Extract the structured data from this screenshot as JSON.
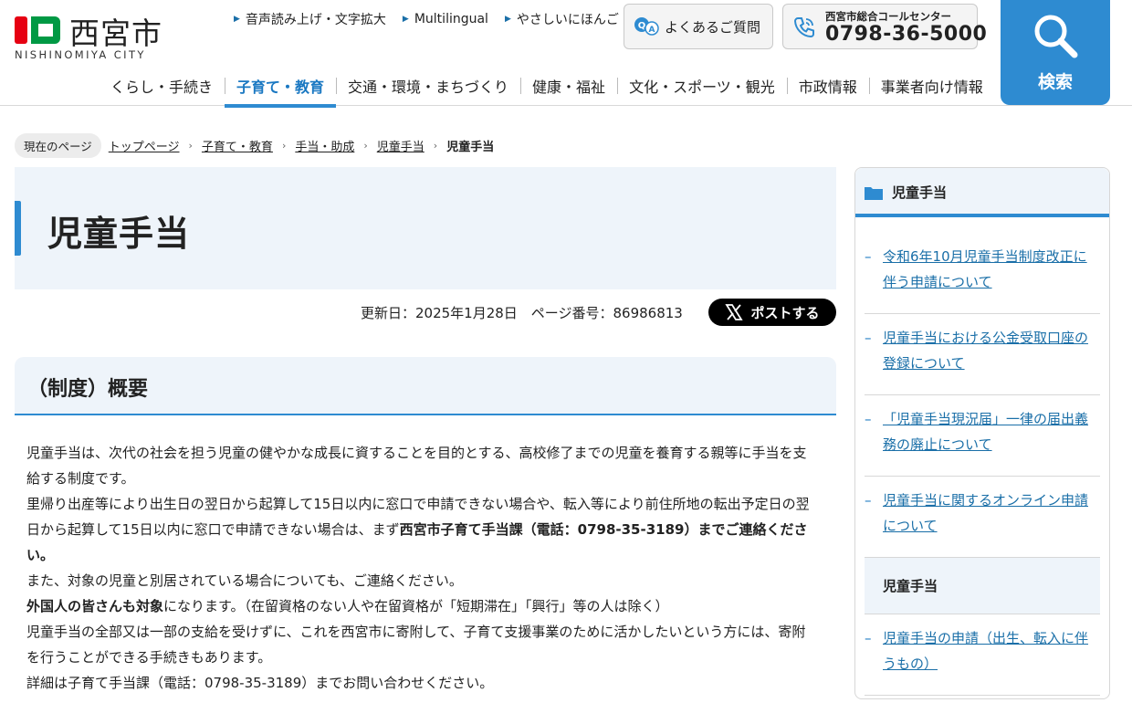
{
  "header": {
    "logo_jp": "西宮市",
    "logo_en": "NISHINOMIYA CITY",
    "util_links": [
      "音声読み上げ・文字拡大",
      "Multilingual",
      "やさしいにほんご"
    ],
    "faq_label": "よくあるご質問",
    "call_center_label": "西宮市総合コールセンター",
    "call_center_number": "0798-36-5000",
    "search_label": "検索",
    "nav": [
      "くらし・手続き",
      "子育て・教育",
      "交通・環境・まちづくり",
      "健康・福祉",
      "文化・スポーツ・観光",
      "市政情報",
      "事業者向け情報"
    ],
    "nav_active_index": 1,
    "brand_color": "#2e8bd1",
    "logo_red": "#e60012",
    "logo_green": "#009944"
  },
  "breadcrumb": {
    "current_label": "現在のページ",
    "links": [
      "トップページ",
      "子育て・教育",
      "手当・助成",
      "児童手当"
    ],
    "here": "児童手当"
  },
  "main": {
    "title": "児童手当",
    "meta": "更新日：2025年1月28日　ページ番号：86986813",
    "post_label": "ポストする",
    "section_title": "（制度）概要",
    "p1": "児童手当は、次代の社会を担う児童の健やかな成長に資することを目的とする、高校修了までの児童を養育する親等に手当を支給する制度です。",
    "p2_a": "里帰り出産等により出生日の翌日から起算して15日以内に窓口で申請できない場合や、転入等により前住所地の転出予定日の翌日から起算して15日以内に窓口で申請できない場合は、まず",
    "p2_b": "西宮市子育て手当課（電話：0798-35-3189）までご連絡ください。",
    "p3": "また、対象の児童と別居されている場合についても、ご連絡ください。",
    "p4_a": "外国人の皆さんも対象",
    "p4_b": "になります。（在留資格のない人や在留資格が「短期滞在」「興行」等の人は除く）",
    "p5": "児童手当の全部又は一部の支給を受けずに、これを西宮市に寄附して、子育て支援事業のために活かしたいという方には、寄附を行うことができる手続きもあります。",
    "p6": "詳細は子育て手当課（電話：0798-35-3189）までお問い合わせください。"
  },
  "sidebar": {
    "title": "児童手当",
    "items": [
      {
        "label": "令和6年10月児童手当制度改正に伴う申請について"
      },
      {
        "label": "児童手当における公金受取口座の登録について"
      },
      {
        "label": "「児童手当現況届」一律の届出義務の廃止について"
      },
      {
        "label": "児童手当に関するオンライン申請について"
      },
      {
        "label": "児童手当"
      },
      {
        "label": "児童手当の申請（出生、転入に伴うもの）"
      }
    ],
    "current_index": 4
  }
}
